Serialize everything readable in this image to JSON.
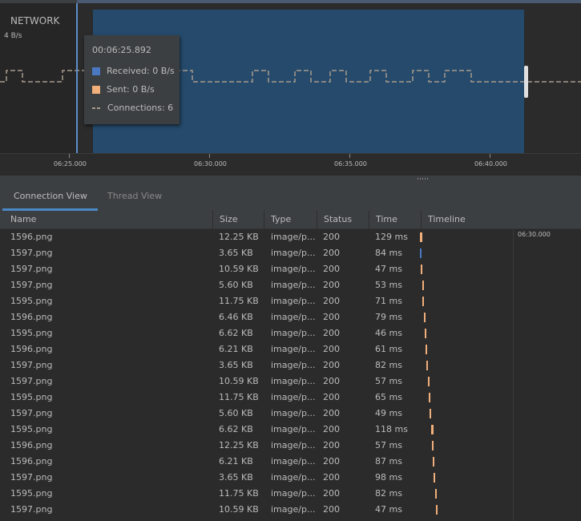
{
  "graph": {
    "title": "NETWORK",
    "axis_label": "4 B/s"
  },
  "tooltip": {
    "timestamp": "00:06:25.892",
    "received": "Received: 0 B/s",
    "sent": "Sent: 0 B/s",
    "connections": "Connections: 6"
  },
  "colors": {
    "received": "#4a78c2",
    "sent": "#f0ae7a",
    "connections": "#a89a8c"
  },
  "time_axis": {
    "ticks": [
      "06:25.000",
      "06:30.000",
      "06:35.000",
      "06:40.000"
    ]
  },
  "tabs": {
    "connection_view": "Connection View",
    "thread_view": "Thread View"
  },
  "table": {
    "columns": [
      "Name",
      "Size",
      "Type",
      "Status",
      "Time",
      "Timeline"
    ],
    "rows": [
      {
        "name": "1596.png",
        "size": "12.25 KB",
        "type": "image/p...",
        "status": "200",
        "time": "129 ms"
      },
      {
        "name": "1597.png",
        "size": "3.65 KB",
        "type": "image/p...",
        "status": "200",
        "time": "84 ms"
      },
      {
        "name": "1597.png",
        "size": "10.59 KB",
        "type": "image/p...",
        "status": "200",
        "time": "47 ms"
      },
      {
        "name": "1597.png",
        "size": "5.60 KB",
        "type": "image/p...",
        "status": "200",
        "time": "53 ms"
      },
      {
        "name": "1595.png",
        "size": "11.75 KB",
        "type": "image/p...",
        "status": "200",
        "time": "71 ms"
      },
      {
        "name": "1596.png",
        "size": "6.46 KB",
        "type": "image/p...",
        "status": "200",
        "time": "79 ms"
      },
      {
        "name": "1595.png",
        "size": "6.62 KB",
        "type": "image/p...",
        "status": "200",
        "time": "46 ms"
      },
      {
        "name": "1596.png",
        "size": "6.21 KB",
        "type": "image/p...",
        "status": "200",
        "time": "61 ms"
      },
      {
        "name": "1597.png",
        "size": "3.65 KB",
        "type": "image/p...",
        "status": "200",
        "time": "82 ms"
      },
      {
        "name": "1597.png",
        "size": "10.59 KB",
        "type": "image/p...",
        "status": "200",
        "time": "57 ms"
      },
      {
        "name": "1595.png",
        "size": "11.75 KB",
        "type": "image/p...",
        "status": "200",
        "time": "65 ms"
      },
      {
        "name": "1597.png",
        "size": "5.60 KB",
        "type": "image/p...",
        "status": "200",
        "time": "49 ms"
      },
      {
        "name": "1595.png",
        "size": "6.62 KB",
        "type": "image/p...",
        "status": "200",
        "time": "118 ms"
      },
      {
        "name": "1596.png",
        "size": "12.25 KB",
        "type": "image/p...",
        "status": "200",
        "time": "57 ms"
      },
      {
        "name": "1596.png",
        "size": "6.21 KB",
        "type": "image/p...",
        "status": "200",
        "time": "87 ms"
      },
      {
        "name": "1597.png",
        "size": "3.65 KB",
        "type": "image/p...",
        "status": "200",
        "time": "98 ms"
      },
      {
        "name": "1595.png",
        "size": "11.75 KB",
        "type": "image/p...",
        "status": "200",
        "time": "82 ms"
      },
      {
        "name": "1597.png",
        "size": "10.59 KB",
        "type": "image/p...",
        "status": "200",
        "time": "47 ms"
      }
    ]
  },
  "timeline_panel": {
    "label": "06:30.000"
  }
}
